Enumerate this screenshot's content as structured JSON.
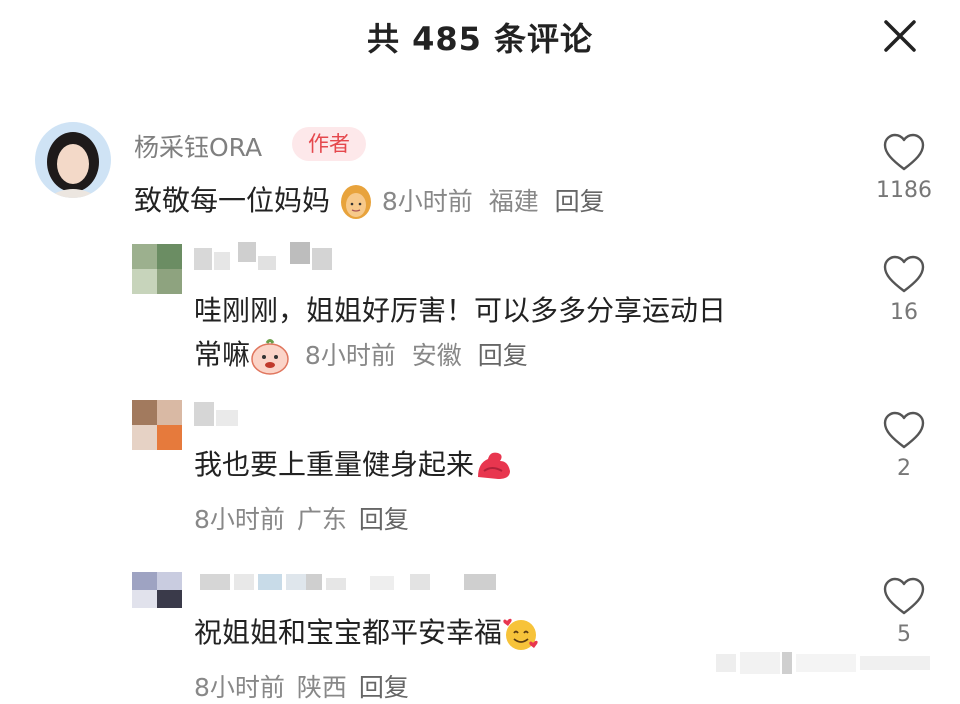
{
  "header": {
    "title": "共 485 条评论",
    "close_icon": "close-icon"
  },
  "comments": [
    {
      "username": "杨采钰ORA",
      "badge": "作者",
      "text": "致敬每一位妈妈",
      "emoji": "woman-emoji",
      "time": "8小时前",
      "location": "福建",
      "reply": "回复",
      "likes": "1186"
    },
    {
      "text_line1": "哇刚刚，姐姐好厉害！可以多多分享运动日",
      "text_line2": "常嘛",
      "emoji": "pleading-character-emoji",
      "time": "8小时前",
      "location": "安徽",
      "reply": "回复",
      "likes": "16"
    },
    {
      "text": "我也要上重量健身起来",
      "emoji": "flexed-biceps-emoji",
      "time": "8小时前",
      "location": "广东",
      "reply": "回复",
      "likes": "2"
    },
    {
      "text": "祝姐姐和宝宝都平安幸福",
      "emoji": "smiling-face-with-hearts-emoji",
      "time": "8小时前",
      "location": "陕西",
      "reply": "回复",
      "likes": "5"
    }
  ],
  "colors": {
    "accent_red": "#e5484d",
    "badge_bg": "#fde8ea",
    "meta_gray": "#888888"
  }
}
